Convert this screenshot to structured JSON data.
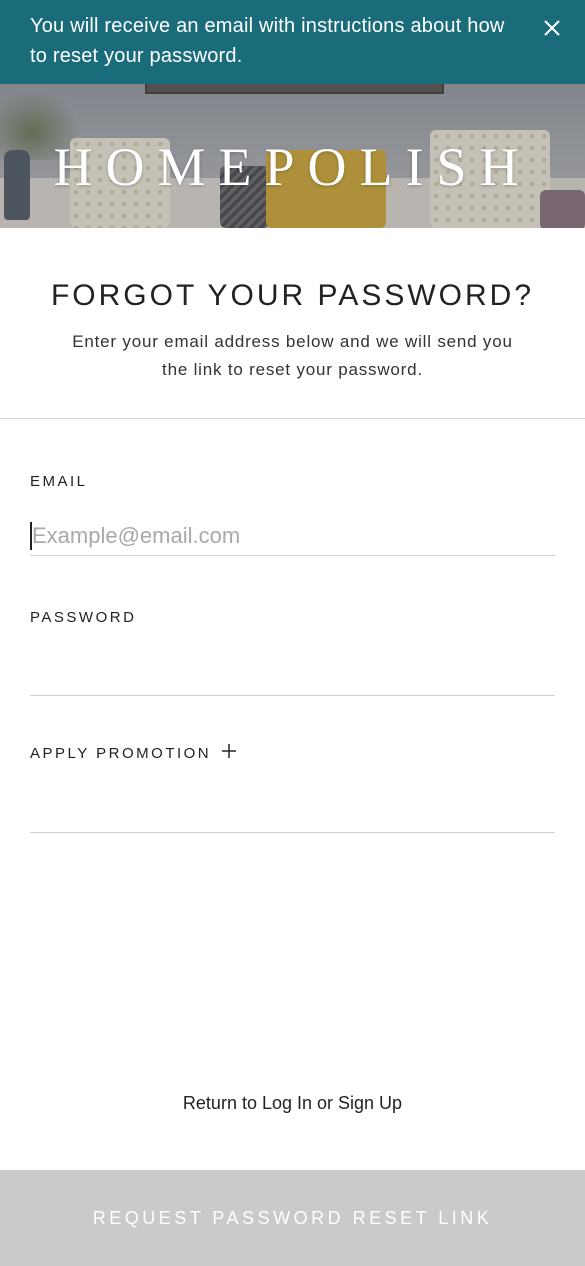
{
  "banner": {
    "message": "You will receive an email with instructions about how to reset your password.",
    "close_icon": "close-icon",
    "background_color": "#1a6c7a"
  },
  "hero": {
    "brand": "HOMEPOLISH"
  },
  "page": {
    "title": "FORGOT YOUR PASSWORD?",
    "subtitle": "Enter your email address below and we will send you the link to reset your password."
  },
  "form": {
    "email_label": "EMAIL",
    "email_placeholder": "Example@email.com",
    "email_value": "",
    "password_label": "PASSWORD",
    "password_value": "",
    "promotion_label": "APPLY PROMOTION",
    "promotion_icon": "plus-icon"
  },
  "footer": {
    "return_link": "Return to Log In or Sign Up"
  },
  "submit": {
    "label": "REQUEST PASSWORD RESET LINK",
    "background_color": "#cacaca"
  }
}
